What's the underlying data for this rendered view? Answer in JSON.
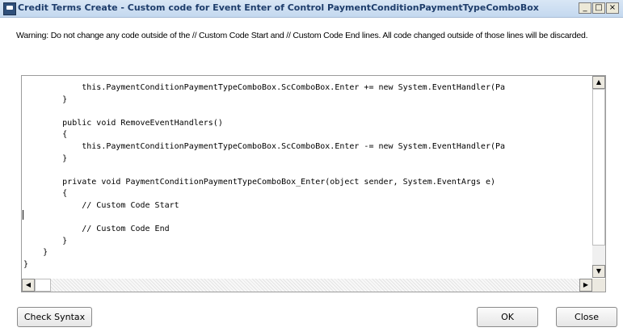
{
  "window": {
    "title": "Credit Terms Create - Custom code for Event Enter of Control PaymentConditionPaymentTypeComboBox",
    "minimize_glyph": "_",
    "maximize_glyph": "□",
    "close_glyph": "×"
  },
  "warning": "Warning: Do not change any code outside of the // Custom Code Start and // Custom Code End lines. All code changed outside of those lines will be discarded.",
  "editor": {
    "code": "            this.PaymentConditionPaymentTypeComboBox.ScComboBox.Enter += new System.EventHandler(Pa\n        }\n\n        public void RemoveEventHandlers()\n        {\n            this.PaymentConditionPaymentTypeComboBox.ScComboBox.Enter -= new System.EventHandler(Pa\n        }\n\n        private void PaymentConditionPaymentTypeComboBox_Enter(object sender, System.EventArgs e)\n        {\n            // Custom Code Start\n\n            // Custom Code End\n        }\n    }\n}",
    "scroll_up_glyph": "▲",
    "scroll_down_glyph": "▼",
    "scroll_left_glyph": "◀",
    "scroll_right_glyph": "▶"
  },
  "buttons": {
    "check_syntax": "Check Syntax",
    "ok": "OK",
    "close": "Close"
  }
}
